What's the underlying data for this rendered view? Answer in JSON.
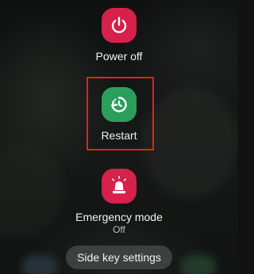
{
  "power_menu": {
    "items": [
      {
        "label": "Power off",
        "icon": "power-icon",
        "color": "#d6214a"
      },
      {
        "label": "Restart",
        "icon": "restart-icon",
        "color": "#2c9e5c",
        "highlighted": true
      },
      {
        "label": "Emergency mode",
        "sublabel": "Off",
        "icon": "emergency-beacon-icon",
        "color": "#d6214a"
      }
    ]
  },
  "side_key_button": {
    "label": "Side key settings"
  },
  "colors": {
    "background": "#121413",
    "accent_red": "#d6214a",
    "accent_green": "#2c9e5c",
    "highlight_border": "#e2231a",
    "pill_background": "#3d403f"
  }
}
